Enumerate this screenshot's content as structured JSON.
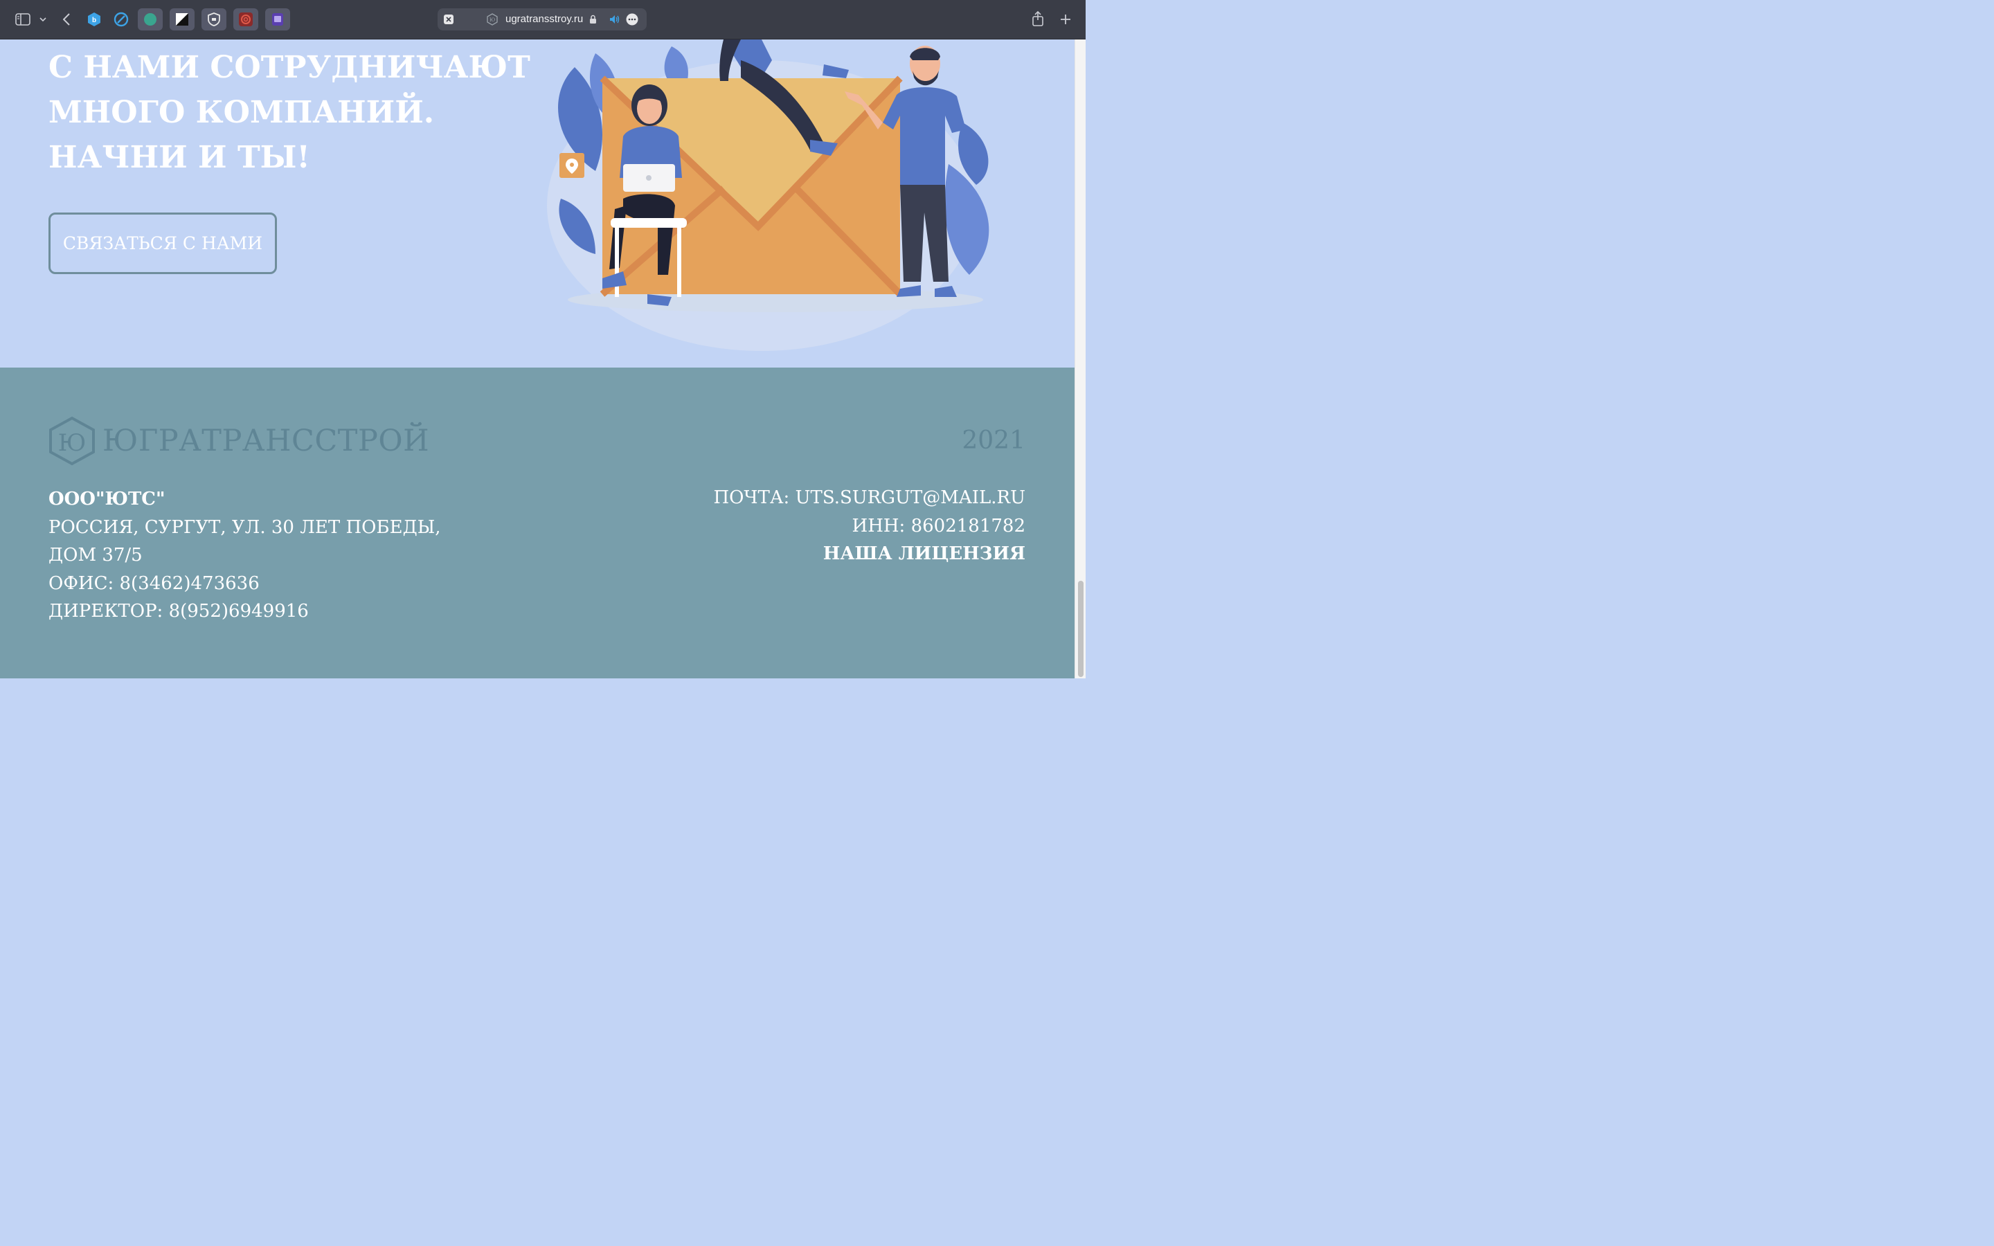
{
  "browser": {
    "url": "ugratransstroy.ru",
    "tab_icons": [
      "hex-logo-icon",
      "compass-icon",
      "green-circle-icon",
      "contrast-icon",
      "shield-icon",
      "red-knot-icon",
      "purple-app-icon"
    ]
  },
  "hero": {
    "title_lines": [
      "С НАМИ СОТРУДНИЧАЮТ",
      "МНОГО КОМПАНИЙ.",
      "НАЧНИ И ТЫ!"
    ],
    "button_label": "СВЯЗАТЬСЯ С НАМИ"
  },
  "footer": {
    "logo_text": "ЮГРАТРАНССТРОЙ",
    "logo_mark": "Ю",
    "year": "2021",
    "company": "ООО\"ЮТС\"",
    "address_line1": "РОССИЯ, СУРГУТ, УЛ. 30 ЛЕТ ПОБЕДЫ,",
    "address_line2": "ДОМ 37/5",
    "office": "ОФИС: 8(3462)473636",
    "director": "ДИРЕКТОР: 8(952)6949916",
    "email": "ПОЧТА: UTS.SURGUT@MAIL.RU",
    "inn": "ИНН: 8602181782",
    "license": "НАША ЛИЦЕНЗИЯ"
  },
  "colors": {
    "hero_bg": "#c2d4f5",
    "footer_bg": "#789eab",
    "logo": "#5f8595",
    "envelope": "#e8a35a"
  }
}
